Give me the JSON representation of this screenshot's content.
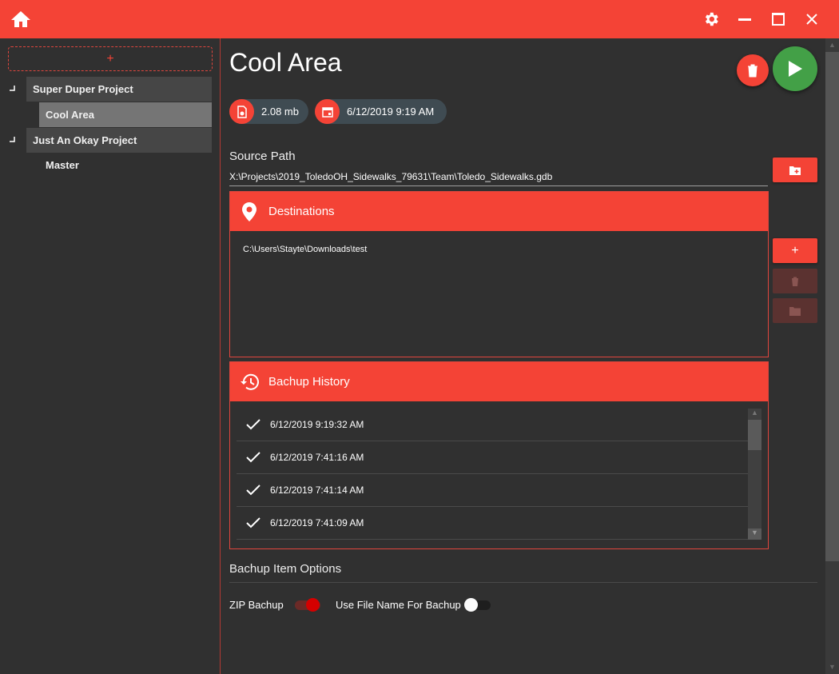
{
  "window": {
    "home_icon": "home-icon",
    "settings_icon": "gear-icon",
    "minimize_icon": "minimize-icon",
    "maximize_icon": "maximize-icon",
    "close_icon": "close-icon"
  },
  "sidebar": {
    "add_label": "+",
    "projects": [
      {
        "label": "Super Duper Project",
        "items": [
          {
            "label": "Cool Area",
            "selected": true
          }
        ]
      },
      {
        "label": "Just An Okay Project",
        "items": [
          {
            "label": "Master",
            "selected": false
          }
        ]
      }
    ]
  },
  "main": {
    "title": "Cool Area",
    "size_chip": "2.08 mb",
    "date_chip": "6/12/2019 9:19 AM",
    "source_path_label": "Source Path",
    "source_path_value": "X:\\Projects\\2019_ToledoOH_Sidewalks_79631\\Team\\Toledo_Sidewalks.gdb",
    "destinations": {
      "title": "Destinations",
      "items": [
        "C:\\Users\\Stayte\\Downloads\\test"
      ]
    },
    "history": {
      "title": "Bachup History",
      "items": [
        "6/12/2019 9:19:32 AM",
        "6/12/2019 7:41:16 AM",
        "6/12/2019 7:41:14 AM",
        "6/12/2019 7:41:09 AM"
      ]
    },
    "options": {
      "title": "Bachup Item Options",
      "zip_label": "ZIP Bachup",
      "zip_on": true,
      "filename_label": "Use File Name For Bachup",
      "filename_on": false
    },
    "side_buttons": {
      "add_destination_label": "+"
    }
  },
  "colors": {
    "accent": "#f44336",
    "run": "#43a047",
    "background": "#303030"
  }
}
